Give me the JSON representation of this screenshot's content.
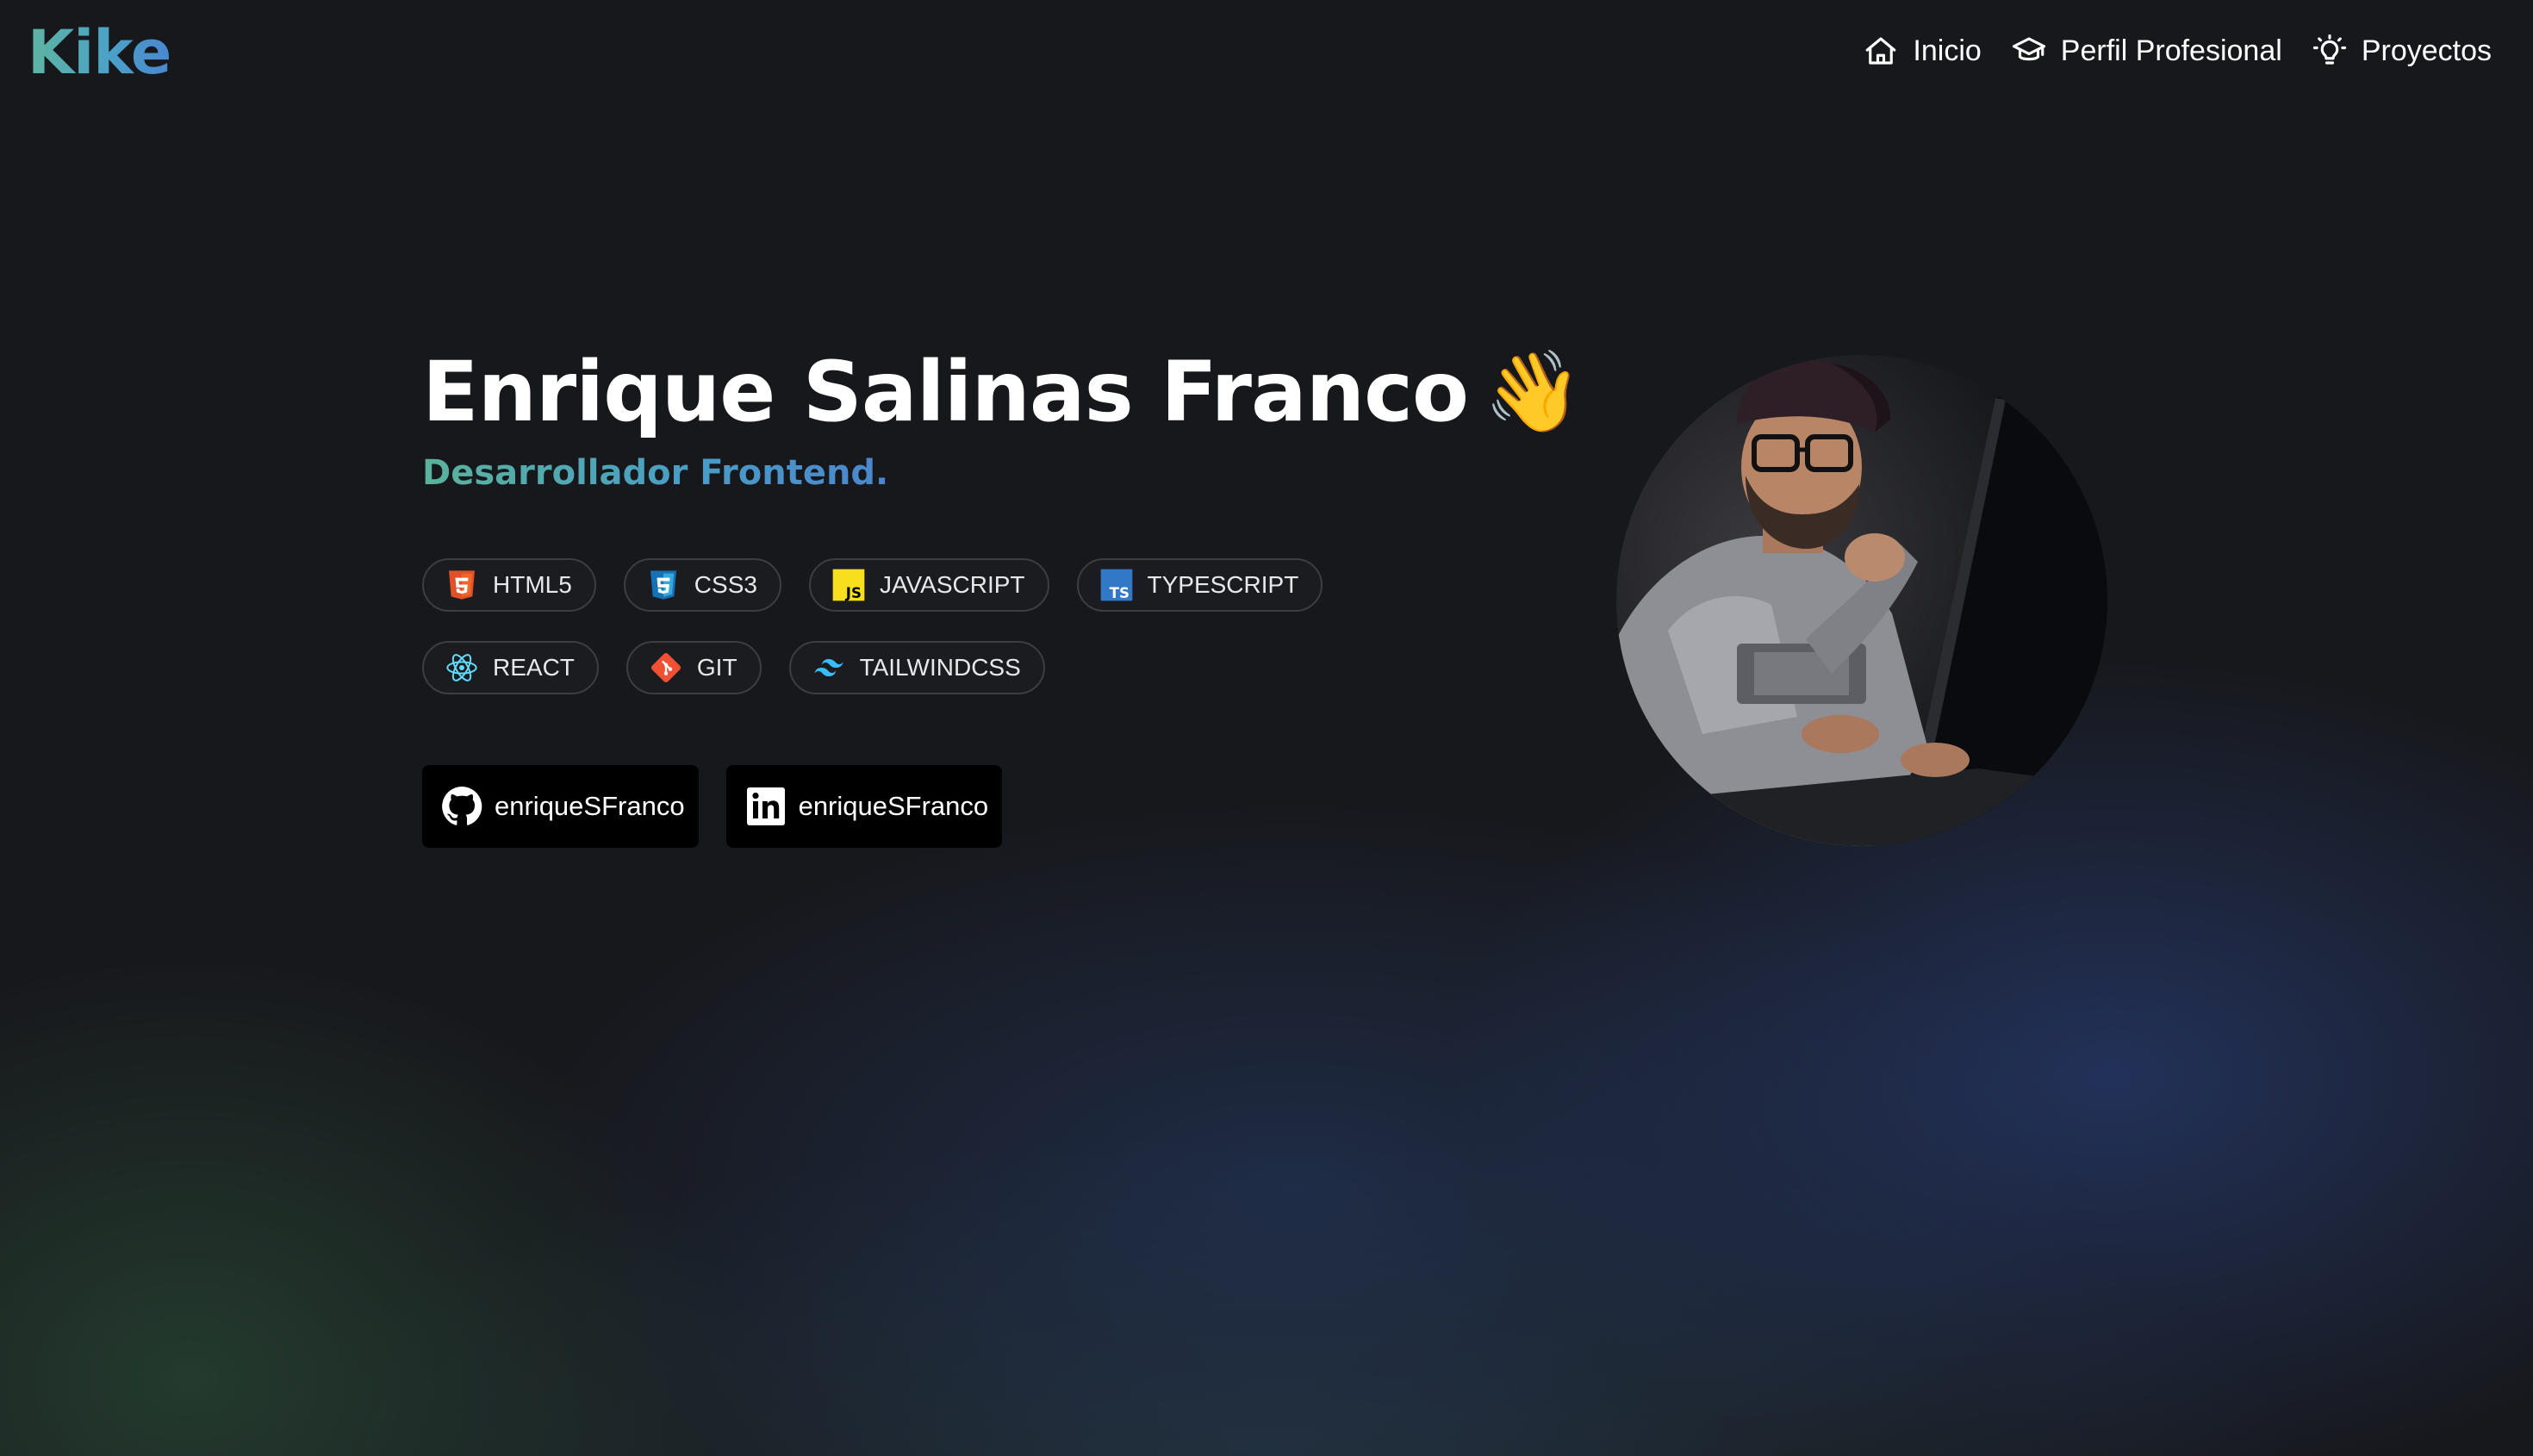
{
  "header": {
    "logo": "Kike",
    "nav": [
      {
        "label": "Inicio",
        "icon": "home-icon"
      },
      {
        "label": "Perfil Profesional",
        "icon": "graduation-cap-icon"
      },
      {
        "label": "Proyectos",
        "icon": "lightbulb-icon"
      }
    ]
  },
  "hero": {
    "name": "Enrique Salinas Franco",
    "wave": "👋",
    "subtitle": "Desarrollador Frontend.",
    "tags_row1": [
      {
        "label": "HTML5",
        "icon": "html5-icon"
      },
      {
        "label": "CSS3",
        "icon": "css3-icon"
      },
      {
        "label": "JAVASCRIPT",
        "icon": "javascript-icon"
      },
      {
        "label": "TYPESCRIPT",
        "icon": "typescript-icon"
      }
    ],
    "tags_row2": [
      {
        "label": "REACT",
        "icon": "react-icon"
      },
      {
        "label": "GIT",
        "icon": "git-icon"
      },
      {
        "label": "TAILWINDCSS",
        "icon": "tailwindcss-icon"
      }
    ],
    "socials": [
      {
        "label": "enriqueSFranco",
        "icon": "github-icon"
      },
      {
        "label": "enriqueSFranco",
        "icon": "linkedin-icon"
      }
    ]
  },
  "colors": {
    "background": "#17181c",
    "accent_green": "#5ab39b",
    "accent_blue": "#4a86cf",
    "tag_border": "#3c3e44"
  }
}
